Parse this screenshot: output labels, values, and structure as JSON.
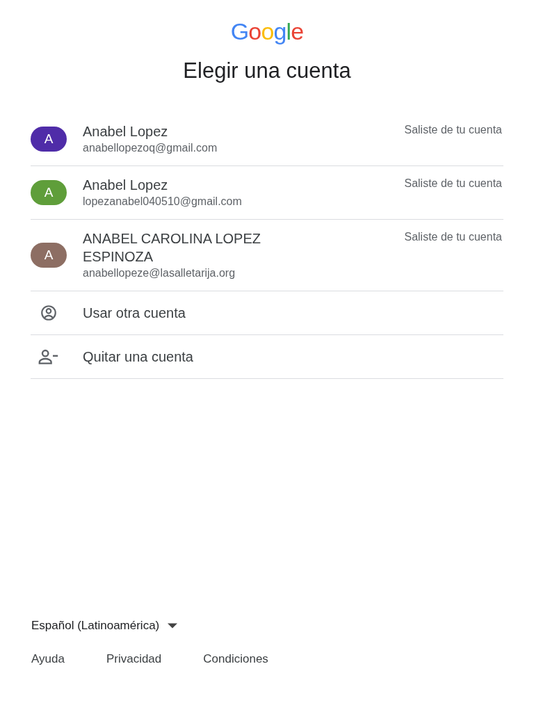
{
  "logo": "Google",
  "title": "Elegir una cuenta",
  "accounts": [
    {
      "initial": "A",
      "color": "#4f2ca8",
      "name": "Anabel Lopez",
      "email": "anabellopezoq@gmail.com",
      "status": "Saliste de tu cuenta"
    },
    {
      "initial": "A",
      "color": "#5f9e3a",
      "name": "Anabel Lopez",
      "email": "lopezanabel040510@gmail.com",
      "status": "Saliste de tu cuenta"
    },
    {
      "initial": "A",
      "color": "#8d6e63",
      "name": "ANABEL CAROLINA LOPEZ ESPINOZA",
      "email": "anabellopeze@lasalletarija.org",
      "status": "Saliste de tu cuenta"
    }
  ],
  "actions": [
    {
      "kind": "add",
      "label": "Usar otra cuenta"
    },
    {
      "kind": "remove",
      "label": "Quitar una cuenta"
    }
  ],
  "language": "Español (Latinoamérica)",
  "footer_links": [
    "Ayuda",
    "Privacidad",
    "Condiciones"
  ]
}
